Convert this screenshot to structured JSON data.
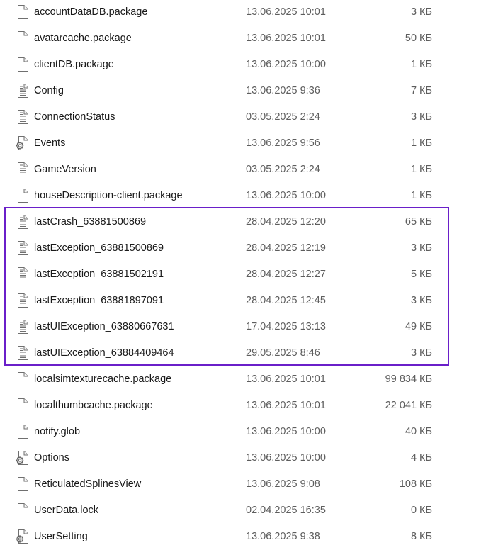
{
  "files": [
    {
      "name": "accountDataDB.package",
      "date": "13.06.2025 10:01",
      "size": "3 КБ",
      "icon": "blank-file-icon"
    },
    {
      "name": "avatarcache.package",
      "date": "13.06.2025 10:01",
      "size": "50 КБ",
      "icon": "blank-file-icon"
    },
    {
      "name": "clientDB.package",
      "date": "13.06.2025 10:00",
      "size": "1 КБ",
      "icon": "blank-file-icon"
    },
    {
      "name": "Config",
      "date": "13.06.2025 9:36",
      "size": "7 КБ",
      "icon": "text-file-icon"
    },
    {
      "name": "ConnectionStatus",
      "date": "03.05.2025 2:24",
      "size": "3 КБ",
      "icon": "text-file-icon"
    },
    {
      "name": "Events",
      "date": "13.06.2025 9:56",
      "size": "1 КБ",
      "icon": "settings-file-icon"
    },
    {
      "name": "GameVersion",
      "date": "03.05.2025 2:24",
      "size": "1 КБ",
      "icon": "text-file-icon"
    },
    {
      "name": "houseDescription-client.package",
      "date": "13.06.2025 10:00",
      "size": "1 КБ",
      "icon": "blank-file-icon"
    },
    {
      "name": "lastCrash_63881500869",
      "date": "28.04.2025 12:20",
      "size": "65 КБ",
      "icon": "text-file-icon"
    },
    {
      "name": "lastException_63881500869",
      "date": "28.04.2025 12:19",
      "size": "3 КБ",
      "icon": "text-file-icon"
    },
    {
      "name": "lastException_63881502191",
      "date": "28.04.2025 12:27",
      "size": "5 КБ",
      "icon": "text-file-icon"
    },
    {
      "name": "lastException_63881897091",
      "date": "28.04.2025 12:45",
      "size": "3 КБ",
      "icon": "text-file-icon"
    },
    {
      "name": "lastUIException_63880667631",
      "date": "17.04.2025 13:13",
      "size": "49 КБ",
      "icon": "text-file-icon"
    },
    {
      "name": "lastUIException_63884409464",
      "date": "29.05.2025 8:46",
      "size": "3 КБ",
      "icon": "text-file-icon"
    },
    {
      "name": "localsimtexturecache.package",
      "date": "13.06.2025 10:01",
      "size": "99 834 КБ",
      "icon": "blank-file-icon"
    },
    {
      "name": "localthumbcache.package",
      "date": "13.06.2025 10:01",
      "size": "22 041 КБ",
      "icon": "blank-file-icon"
    },
    {
      "name": "notify.glob",
      "date": "13.06.2025 10:00",
      "size": "40 КБ",
      "icon": "blank-file-icon"
    },
    {
      "name": "Options",
      "date": "13.06.2025 10:00",
      "size": "4 КБ",
      "icon": "settings-file-icon"
    },
    {
      "name": "ReticulatedSplinesView",
      "date": "13.06.2025 9:08",
      "size": "108 КБ",
      "icon": "blank-file-icon"
    },
    {
      "name": "UserData.lock",
      "date": "02.04.2025 16:35",
      "size": "0 КБ",
      "icon": "blank-file-icon"
    },
    {
      "name": "UserSetting",
      "date": "13.06.2025 9:38",
      "size": "8 КБ",
      "icon": "settings-file-icon"
    }
  ],
  "highlight": {
    "color": "#6a1fc9"
  }
}
